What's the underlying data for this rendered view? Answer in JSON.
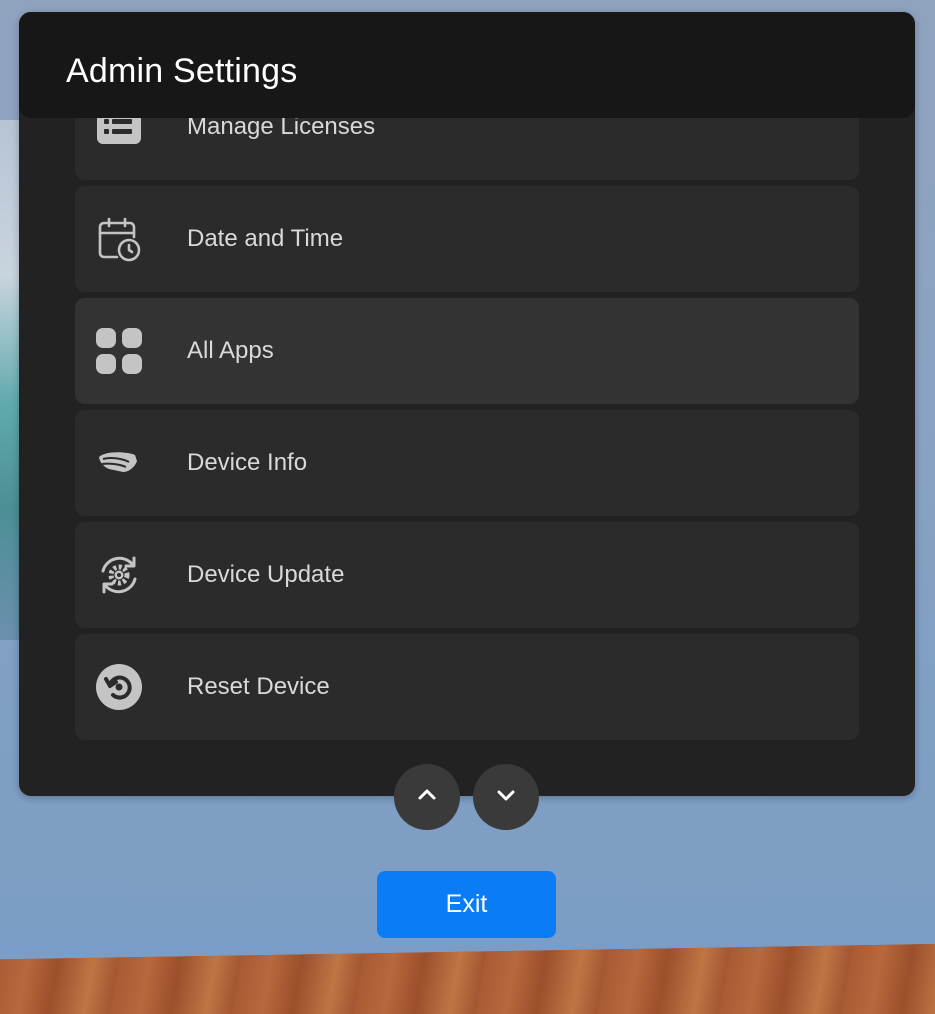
{
  "panel": {
    "title": "Admin Settings"
  },
  "menu": {
    "items": [
      {
        "label": "Manage Licenses",
        "icon": "license-icon"
      },
      {
        "label": "Date and Time",
        "icon": "calendar-clock-icon"
      },
      {
        "label": "All Apps",
        "icon": "apps-grid-icon"
      },
      {
        "label": "Device Info",
        "icon": "headset-icon"
      },
      {
        "label": "Device Update",
        "icon": "gear-refresh-icon"
      },
      {
        "label": "Reset Device",
        "icon": "reset-icon"
      }
    ]
  },
  "navigation": {
    "scroll_up_icon": "chevron-up-icon",
    "scroll_down_icon": "chevron-down-icon"
  },
  "footer": {
    "exit_label": "Exit"
  },
  "colors": {
    "panel_bg": "#222222",
    "header_bg": "#171717",
    "item_bg": "#2b2b2b",
    "item_highlight_bg": "#333333",
    "accent": "#0a7cf5",
    "icon": "#c4c4c4"
  }
}
